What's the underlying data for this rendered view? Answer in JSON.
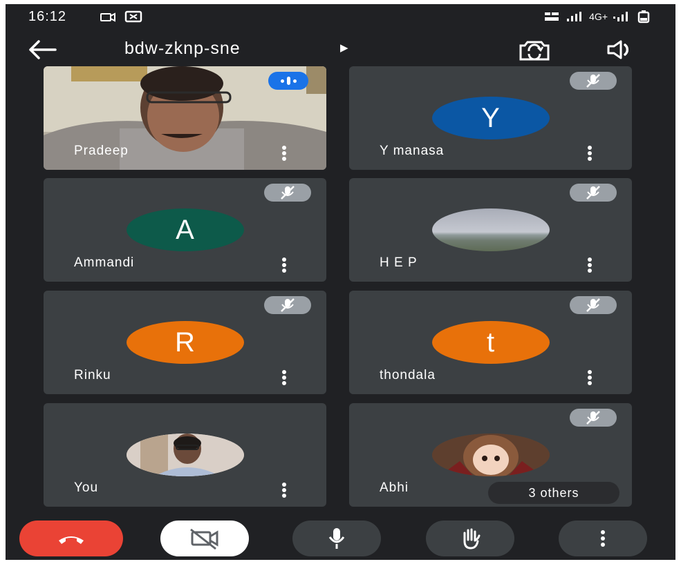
{
  "status": {
    "time": "16:12",
    "network": "4G+"
  },
  "topbar": {
    "meeting_code": "bdw-zknp-sne"
  },
  "participants": [
    {
      "name": "Pradeep",
      "avatar_letter": "",
      "avatar_color": "",
      "muted": false,
      "speaking": true
    },
    {
      "name": "Y manasa",
      "avatar_letter": "Y",
      "avatar_color": "#0b57a4",
      "muted": true
    },
    {
      "name": "Ammandi",
      "avatar_letter": "A",
      "avatar_color": "#0d5a4a",
      "muted": true
    },
    {
      "name": "H E P",
      "avatar_letter": "",
      "avatar_color": "",
      "muted": true
    },
    {
      "name": "Rinku",
      "avatar_letter": "R",
      "avatar_color": "#e8710a",
      "muted": true
    },
    {
      "name": "thondala",
      "avatar_letter": "t",
      "avatar_color": "#e8710a",
      "muted": true
    },
    {
      "name": "You",
      "avatar_letter": "",
      "avatar_color": "",
      "muted": false
    },
    {
      "name": "Abhi",
      "avatar_letter": "",
      "avatar_color": "",
      "muted": true
    }
  ],
  "others_chip": "3 others",
  "controls": {
    "icons": [
      "end-call-icon",
      "camera-off-icon",
      "mic-icon",
      "raise-hand-icon",
      "more-options-icon"
    ]
  },
  "colors": {
    "background": "#202124",
    "tile": "#3c4043",
    "end_call": "#ea4335",
    "speaking": "#1a73e8",
    "mute_chip": "#9aa0a6"
  }
}
